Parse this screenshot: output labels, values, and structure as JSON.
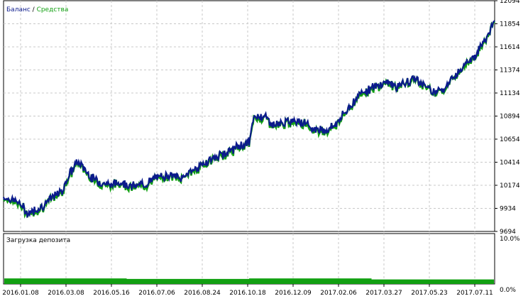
{
  "colors": {
    "balance": "#0b1a8c",
    "equity": "#12a012",
    "grid": "#c8c8c8",
    "frame": "#000000",
    "load": "#12a012"
  },
  "legend": {
    "balance_label": "Баланс",
    "separator": " / ",
    "equity_label": "Средства"
  },
  "load_panel": {
    "title": "Загрузка депозита",
    "max_label": "10.0%",
    "min_label": "0.0%"
  },
  "chart_data": [
    {
      "type": "line",
      "title": "",
      "series": [
        {
          "name": "Баланс",
          "color": "#0b1a8c"
        },
        {
          "name": "Средства",
          "color": "#12a012"
        }
      ],
      "ylim": [
        9694,
        12094
      ],
      "y_ticks": [
        12094,
        11854,
        11614,
        11374,
        11134,
        10894,
        10654,
        10414,
        10174,
        9934,
        9694
      ],
      "x_ticks": [
        "2016.01.08",
        "2016.03.08",
        "2016.05.16",
        "2016.07.06",
        "2016.08.24",
        "2016.10.18",
        "2016.12.09",
        "2017.02.06",
        "2017.03.27",
        "2017.05.23",
        "2017.07.11"
      ],
      "grid": true,
      "legend_position": "top-left",
      "x": [
        0,
        0.03,
        0.05,
        0.065,
        0.08,
        0.1,
        0.12,
        0.13,
        0.15,
        0.165,
        0.18,
        0.2,
        0.22,
        0.24,
        0.26,
        0.29,
        0.31,
        0.34,
        0.36,
        0.38,
        0.4,
        0.42,
        0.44,
        0.46,
        0.48,
        0.5,
        0.51,
        0.53,
        0.55,
        0.57,
        0.6,
        0.63,
        0.66,
        0.68,
        0.7,
        0.72,
        0.73,
        0.76,
        0.78,
        0.8,
        0.82,
        0.84,
        0.86,
        0.88,
        0.9,
        0.92,
        0.94,
        0.96,
        0.98,
        1.0
      ],
      "values": [
        10050,
        10000,
        9880,
        9920,
        9960,
        10050,
        10120,
        10250,
        10420,
        10350,
        10250,
        10200,
        10180,
        10210,
        10160,
        10190,
        10250,
        10290,
        10240,
        10320,
        10370,
        10440,
        10480,
        10530,
        10580,
        10620,
        10880,
        10900,
        10800,
        10820,
        10860,
        10760,
        10750,
        10830,
        10960,
        11090,
        11150,
        11200,
        11260,
        11200,
        11240,
        11290,
        11200,
        11150,
        11200,
        11320,
        11450,
        11520,
        11680,
        11880
      ]
    },
    {
      "type": "area",
      "title": "Загрузка депозита",
      "ylim": [
        0,
        10
      ],
      "y_ticks": [
        "10.0%",
        "0.0%"
      ],
      "values": [
        1.1,
        1.0,
        1.1,
        0.9
      ]
    }
  ]
}
